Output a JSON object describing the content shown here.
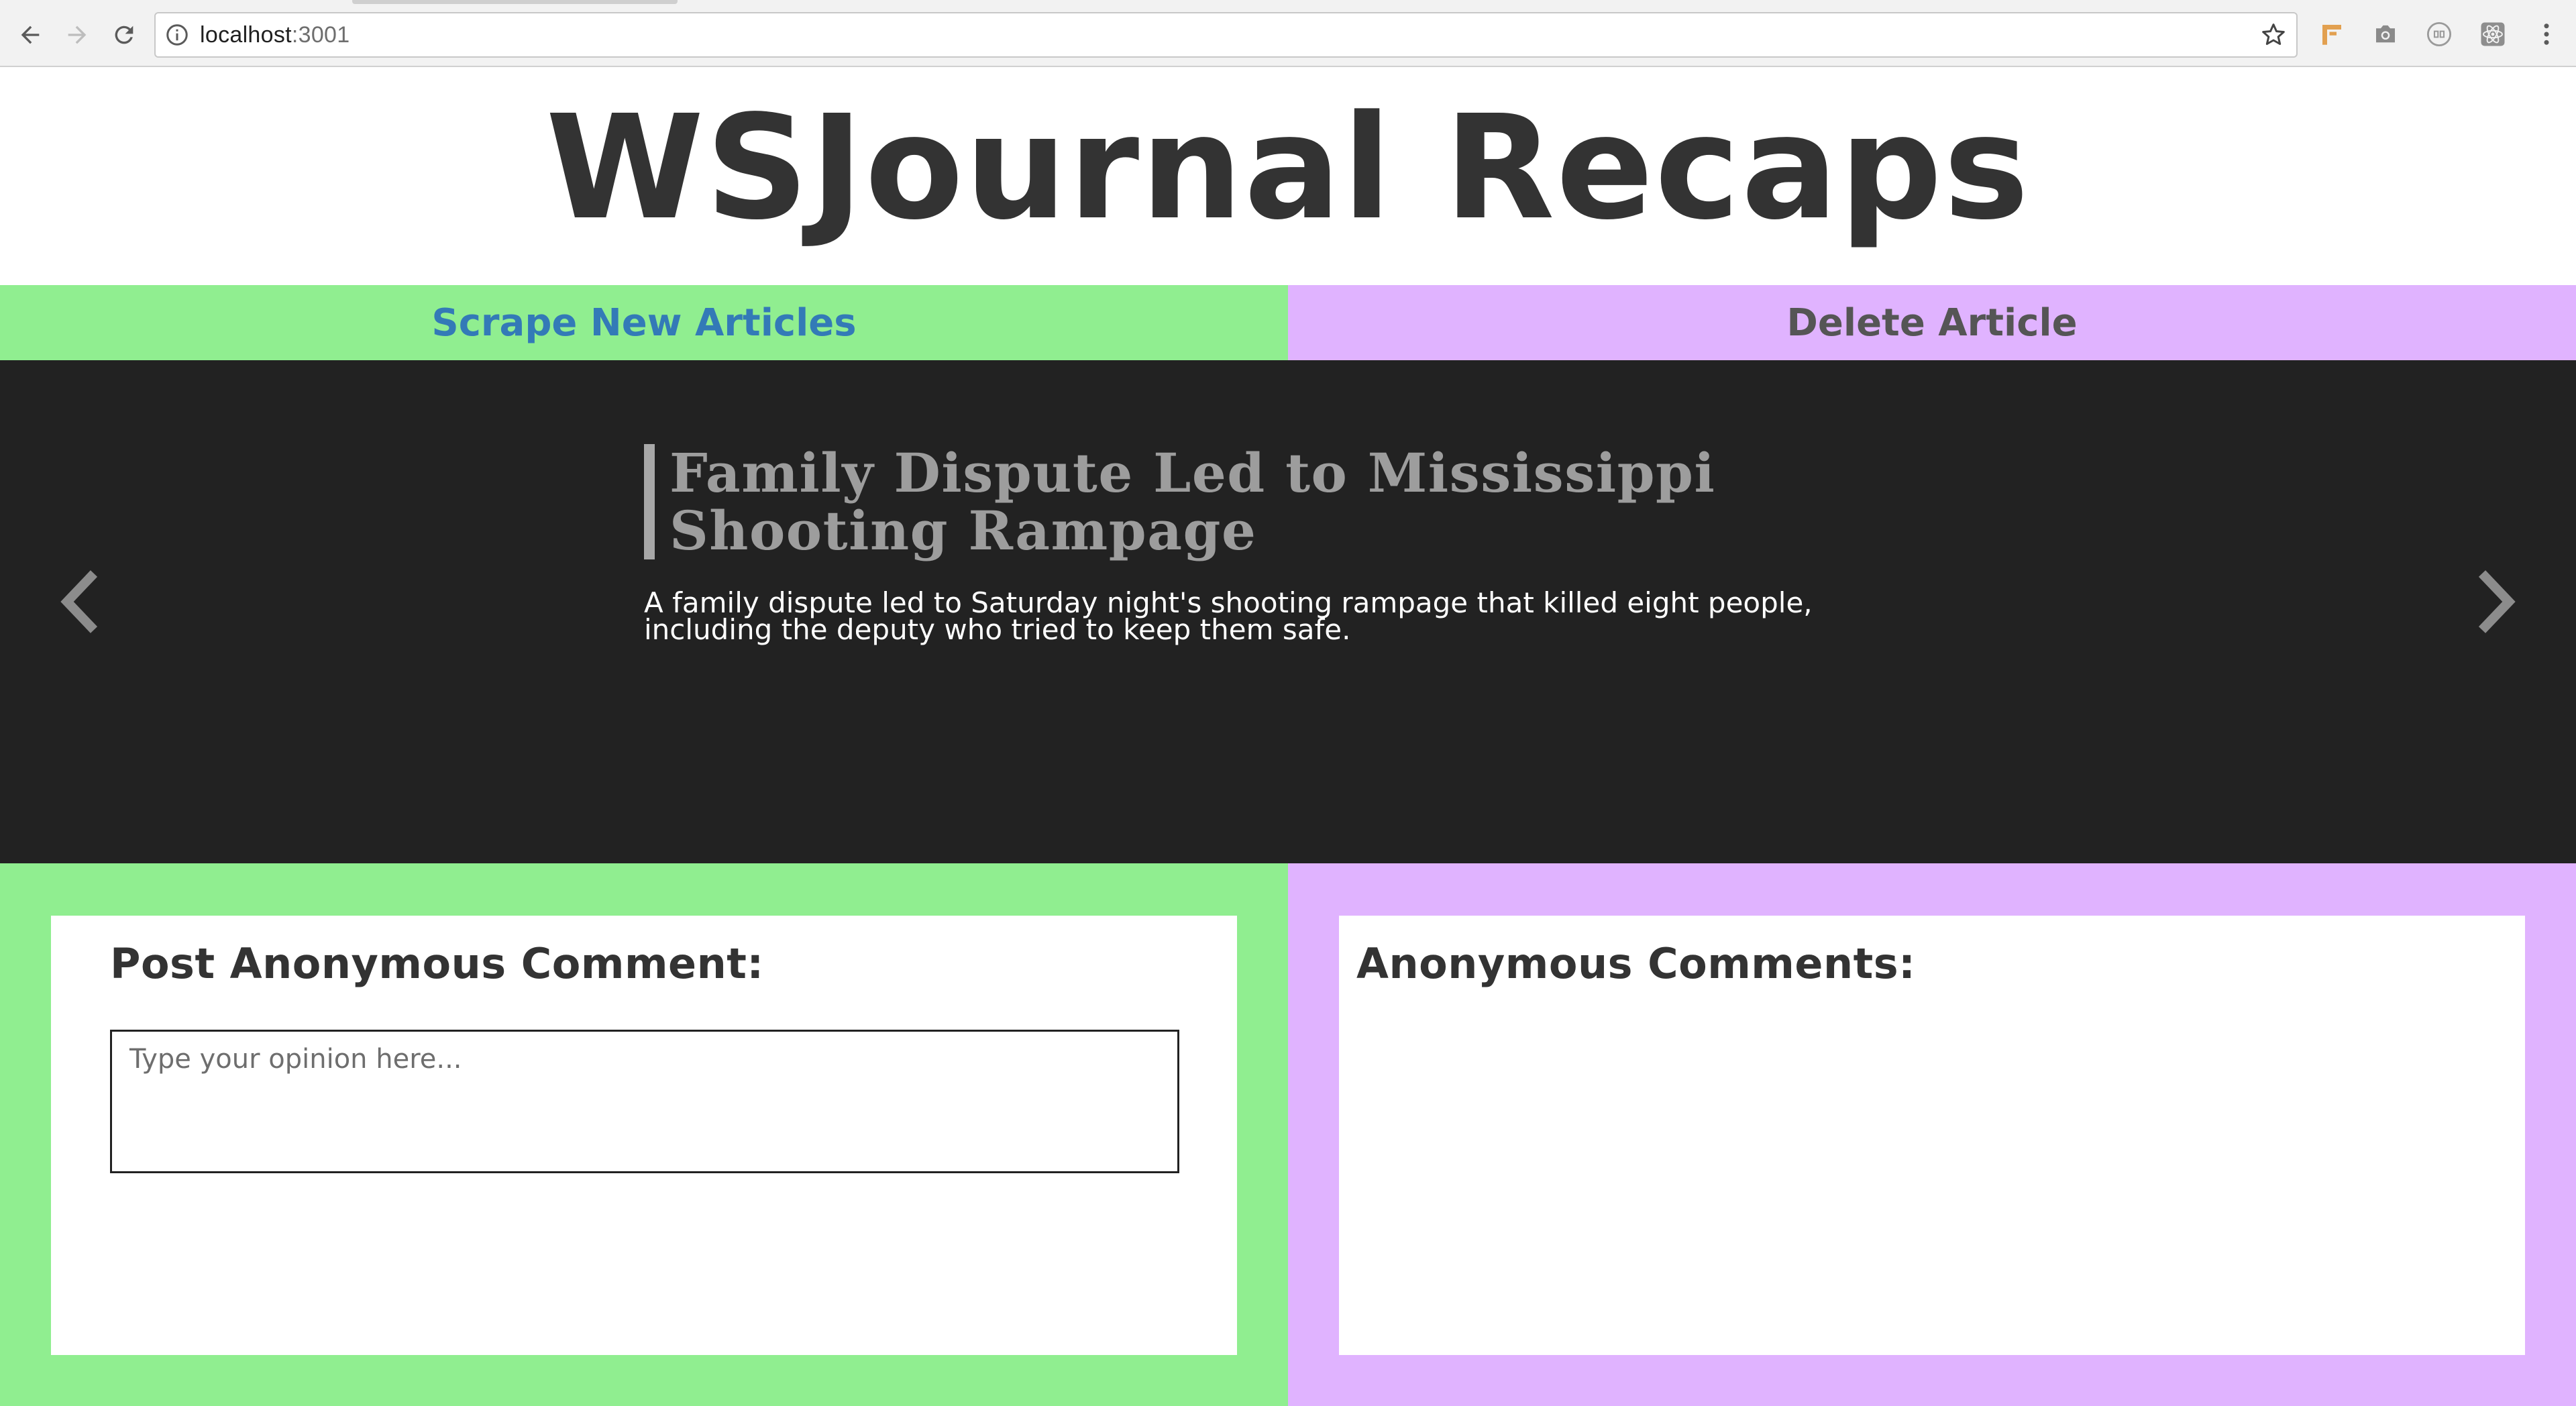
{
  "browser": {
    "url_host": "localhost",
    "url_port": ":3001",
    "icons": {
      "back": "back-arrow-icon",
      "forward": "forward-arrow-icon",
      "reload": "reload-icon",
      "info": "info-icon",
      "bookmark": "star-icon",
      "extensions": [
        "bookmark-extension-icon",
        "camera-icon",
        "ghostery-icon",
        "react-devtools-icon"
      ],
      "menu": "kebab-menu-icon"
    }
  },
  "header": {
    "title": "WSJournal Recaps"
  },
  "actions": {
    "scrape_label": "Scrape New Articles",
    "delete_label": "Delete Article"
  },
  "carousel": {
    "article": {
      "title": "Family Dispute Led to Mississippi Shooting Rampage",
      "summary": "A family dispute led to Saturday night's shooting rampage that killed eight people, including the deputy who tried to keep them safe."
    }
  },
  "comments": {
    "post_heading": "Post Anonymous Comment:",
    "input_placeholder": "Type your opinion here...",
    "input_value": "",
    "list_heading": "Anonymous Comments:",
    "items": []
  },
  "colors": {
    "green_panel": "#90ee90",
    "purple_panel": "#e0b3ff",
    "carousel_bg": "#222222",
    "scrape_text": "#337ab7",
    "title_text": "#333333"
  }
}
